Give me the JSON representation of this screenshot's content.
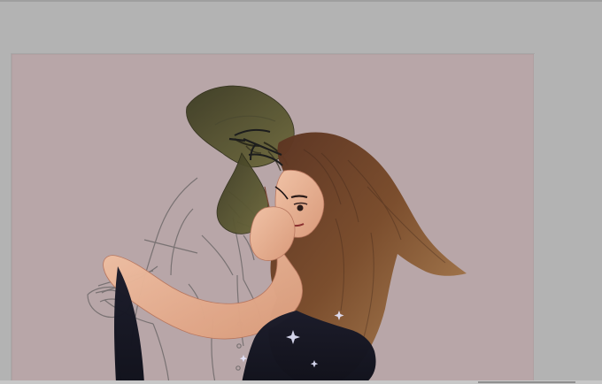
{
  "app": {
    "workspace_color": "#b3b3b3",
    "canvas_color": "#b8a6a8"
  },
  "artwork": {
    "subject": "illustration-in-progress",
    "icons": [
      "canvas-artwork"
    ]
  }
}
